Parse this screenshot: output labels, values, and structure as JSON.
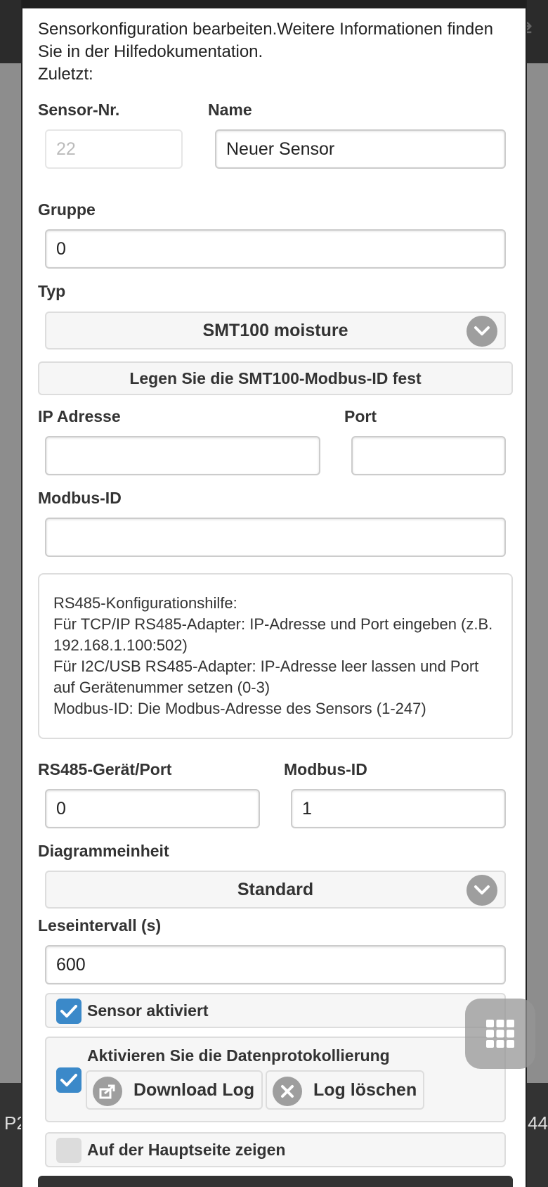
{
  "background": {
    "left_text": "P2",
    "right_text": "44"
  },
  "intro": {
    "line1": "Sensorkonfiguration bearbeiten.Weitere Informationen finden Sie in der Hilfedokumentation.",
    "line2": "Zuletzt:"
  },
  "fields": {
    "sensor_nr_label": "Sensor-Nr.",
    "sensor_nr_value": "22",
    "name_label": "Name",
    "name_value": "Neuer Sensor",
    "group_label": "Gruppe",
    "group_value": "0",
    "type_label": "Typ",
    "type_value": "SMT100 moisture",
    "set_modbus_id_button": "Legen Sie die SMT100-Modbus-ID fest",
    "ip_label": "IP Adresse",
    "ip_value": "",
    "port_label": "Port",
    "port_value": "",
    "modbus_id_label": "Modbus-ID",
    "modbus_id_value": ""
  },
  "help": {
    "title": "RS485-Konfigurationshilfe:",
    "line1": "Für TCP/IP RS485-Adapter: IP-Adresse und Port eingeben (z.B. 192.168.1.100:502)",
    "line2": "Für I2C/USB RS485-Adapter: IP-Adresse leer lassen und Port auf Gerätenummer setzen (0-3)",
    "line3": "Modbus-ID: Die Modbus-Adresse des Sensors (1-247)"
  },
  "rs485": {
    "device_label": "RS485-Gerät/Port",
    "device_value": "0",
    "modbus_label": "Modbus-ID",
    "modbus_value": "1"
  },
  "chart_unit": {
    "label": "Diagrammeinheit",
    "value": "Standard"
  },
  "interval": {
    "label": "Leseintervall (s)",
    "value": "600"
  },
  "checks": {
    "enabled_label": "Sensor aktiviert",
    "enabled": true,
    "logging_label": "Aktivieren Sie die Datenprotokollierung",
    "logging": true,
    "download_log": "Download Log",
    "delete_log": "Log löschen",
    "show_main_label": "Auf der Hauptseite zeigen",
    "show_main": false
  },
  "colors": {
    "accent": "#3b89c9",
    "icon_grey": "#9e9e9e"
  }
}
